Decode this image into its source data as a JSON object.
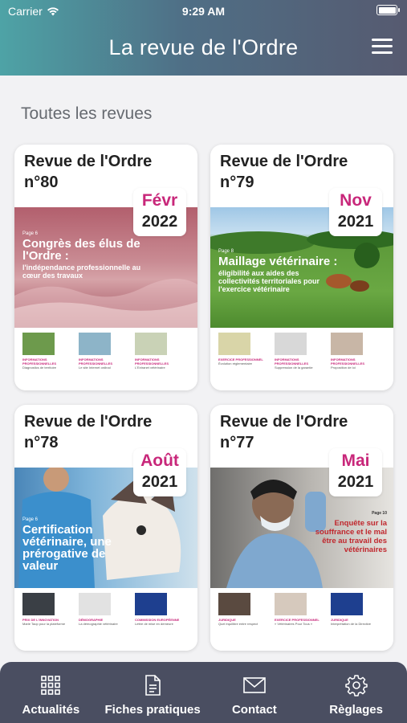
{
  "status_bar": {
    "carrier": "Carrier",
    "time": "9:29 AM"
  },
  "header": {
    "title": "La revue de l'Ordre",
    "menu_icon": "hamburger-icon"
  },
  "section": {
    "title": "Toutes les revues"
  },
  "revues": [
    {
      "title": "Revue de l'Ordre n°80",
      "month": "Févr",
      "year": "2022",
      "cover_color": "#c77b86",
      "cover": {
        "page": "Page 6",
        "headline": "Congrès des élus de l'Ordre :",
        "subline": "l'indépendance professionnelle au cœur des travaux"
      }
    },
    {
      "title": "Revue de l'Ordre n°79",
      "month": "Nov",
      "year": "2021",
      "cover_color": "#5f9b3c",
      "cover": {
        "page": "Page 8",
        "headline": "Maillage vétérinaire :",
        "subline": "éligibilité aux aides des collectivités territoriales pour l'exercice vétérinaire"
      }
    },
    {
      "title": "Revue de l'Ordre n°78",
      "month": "Août",
      "year": "2021",
      "cover_color": "#6aa6cf",
      "cover": {
        "page": "Page 6",
        "headline": "Certification vétérinaire, une prérogative de valeur",
        "subline": ""
      }
    },
    {
      "title": "Revue de l'Ordre n°77",
      "month": "Mai",
      "year": "2021",
      "cover_color": "#bfc6cc",
      "cover": {
        "page": "Page 10",
        "headline": "Enquête sur la souffrance et le mal être au travail des vétérinaires",
        "subline": ""
      }
    }
  ],
  "tabs": [
    {
      "label": "Actualités",
      "icon": "grid-icon"
    },
    {
      "label": "Fiches pratiques",
      "icon": "document-icon"
    },
    {
      "label": "Contact",
      "icon": "envelope-icon"
    },
    {
      "label": "Règlages",
      "icon": "gear-icon"
    }
  ],
  "colors": {
    "accent": "#c8277a",
    "header_start": "#4ea3a6",
    "header_end": "#565a70",
    "tabbar": "#4a4e61"
  }
}
